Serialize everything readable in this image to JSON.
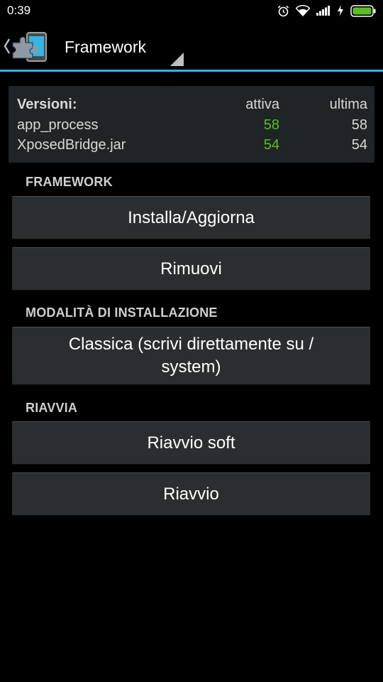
{
  "status_bar": {
    "time": "0:39",
    "icons": [
      "alarm-icon",
      "wifi-icon",
      "signal-icon",
      "charging-icon",
      "battery-icon"
    ],
    "battery_color": "#5bbf21"
  },
  "action_bar": {
    "title": "Framework",
    "accent_color": "#33b5e5"
  },
  "versions": {
    "header": {
      "label": "Versioni:",
      "active": "attiva",
      "latest": "ultima"
    },
    "rows": [
      {
        "name": "app_process",
        "active": "58",
        "latest": "58"
      },
      {
        "name": "XposedBridge.jar",
        "active": "54",
        "latest": "54"
      }
    ],
    "active_color": "#5bbf21"
  },
  "sections": {
    "framework": {
      "label": "FRAMEWORK",
      "install_button": "Installa/Aggiorna",
      "remove_button": "Rimuovi"
    },
    "install_mode": {
      "label": "MODALITÀ DI INSTALLAZIONE",
      "classic_button": "Classica (scrivi direttamente su / system)"
    },
    "reboot": {
      "label": "RIAVVIA",
      "soft_reboot_button": "Riavvio soft",
      "reboot_button": "Riavvio"
    }
  }
}
